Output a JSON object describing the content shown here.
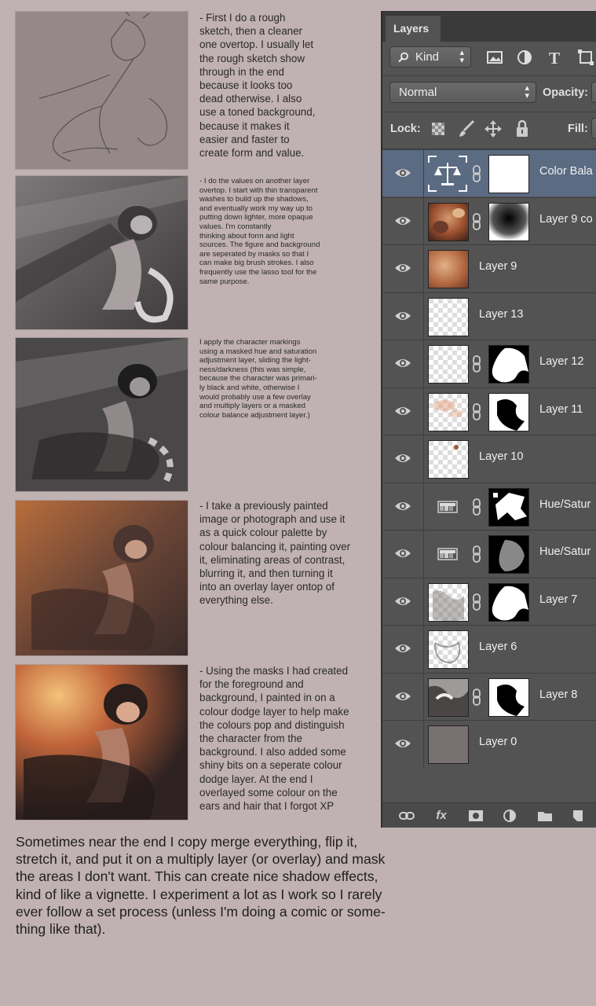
{
  "steps": [
    {
      "text": "- First I do a rough\nsketch, then a cleaner\none overtop. I usually let\nthe rough sketch show\nthrough in the end\n because it looks too\ndead otherwise. I also\nuse a toned background,\nbecause it makes it\neasier and faster to\ncreate form and value."
    },
    {
      "text": "- I do the values on another layer\novertop. I start with thin transparent\nwashes to build up the shadows,\nand eventually work my way up to\nputting down lighter, more opaque\nvalues. I'm constantly\n thinking about form and light\nsources. The figure and background\nare seperated by masks so that I\ncan make big brush strokes. I also\nfrequently use the lasso tool for the\nsame purpose."
    },
    {
      "text": "I apply the character markings\nusing a masked hue and saturation\nadjustment layer, sliding the light-\nness/darkness (this was simple,\nbecause the character was primari-\nly black and white, otherwise I\nwould probably use a few overlay\nand multiply layers or a masked\ncolour balance adjustment layer.)"
    },
    {
      "text": "- I take a previously painted\nimage or photograph and use it\nas a quick colour palette by\ncolour balancing it, painting over\nit, eliminating areas of contrast,\nblurring it, and then turning it\ninto an overlay layer ontop of\neverything else."
    },
    {
      "text": "- Using the masks I had created\nfor the foreground and\n background, I painted in on a\ncolour dodge layer to help make\nthe colours pop and distinguish\nthe character from the\n background. I also added some\nshiny bits on a seperate colour\ndodge layer. At the end I\n overlayed some colour on the\nears and hair that I forgot XP"
    }
  ],
  "bottom_text": "Sometimes near the end I copy merge everything, flip it,\nstretch it, and put it on a multiply layer (or overlay) and mask\nthe areas I don't want. This can create nice shadow effects,\nkind of like a vignette. I experiment a lot as I work so I rarely\never follow a set process (unless I'm doing a comic or some-\nthing like that).",
  "panel": {
    "tab_label": "Layers",
    "kind_label": "Kind",
    "blend_mode": "Normal",
    "opacity_label": "Opacity:",
    "lock_label": "Lock:",
    "fill_label": "Fill:",
    "layers": [
      {
        "name": "Color Bala",
        "selected": true
      },
      {
        "name": "Layer 9 co"
      },
      {
        "name": "Layer 9"
      },
      {
        "name": "Layer 13"
      },
      {
        "name": "Layer 12"
      },
      {
        "name": "Layer 11"
      },
      {
        "name": "Layer 10"
      },
      {
        "name": "Hue/Satur"
      },
      {
        "name": "Hue/Satur"
      },
      {
        "name": "Layer 7"
      },
      {
        "name": "Layer 6"
      },
      {
        "name": "Layer 8"
      },
      {
        "name": "Layer 0"
      }
    ],
    "footer_icons": [
      "link-icon",
      "fx-icon",
      "mask-icon",
      "adjustment-icon",
      "folder-icon",
      "new-layer-icon"
    ],
    "fx_label": "fx"
  }
}
